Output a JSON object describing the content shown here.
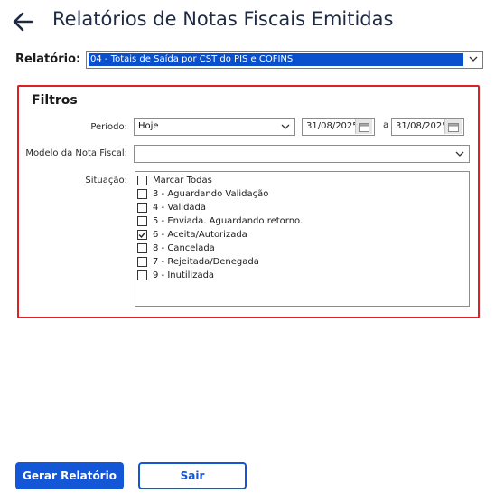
{
  "header": {
    "back_icon": "arrow-left-icon",
    "title": "Relatórios de Notas Fiscais Emitidas"
  },
  "report": {
    "label": "Relatório:",
    "selected": "04 - Totais de Saída por CST do PIS e COFINS"
  },
  "filters": {
    "title": "Filtros",
    "periodo": {
      "label": "Período:",
      "value": "Hoje",
      "date_from": "31/08/2025",
      "separator": "a",
      "date_to": "31/08/2025"
    },
    "modelo": {
      "label": "Modelo da Nota Fiscal:",
      "value": ""
    },
    "situacao": {
      "label": "Situação:",
      "items": [
        {
          "label": "Marcar Todas",
          "checked": false
        },
        {
          "label": "3 - Aguardando Validação",
          "checked": false
        },
        {
          "label": "4 - Validada",
          "checked": false
        },
        {
          "label": "5 - Enviada. Aguardando retorno.",
          "checked": false
        },
        {
          "label": "6 - Aceita/Autorizada",
          "checked": true
        },
        {
          "label": "8 - Cancelada",
          "checked": false
        },
        {
          "label": "7 - Rejeitada/Denegada",
          "checked": false
        },
        {
          "label": "9 - Inutilizada",
          "checked": false
        }
      ]
    }
  },
  "actions": {
    "generate": "Gerar Relatório",
    "exit": "Sair"
  },
  "colors": {
    "accent": "#1357d6",
    "highlight_border": "#dd1f26",
    "selection": "#0a50cc"
  }
}
